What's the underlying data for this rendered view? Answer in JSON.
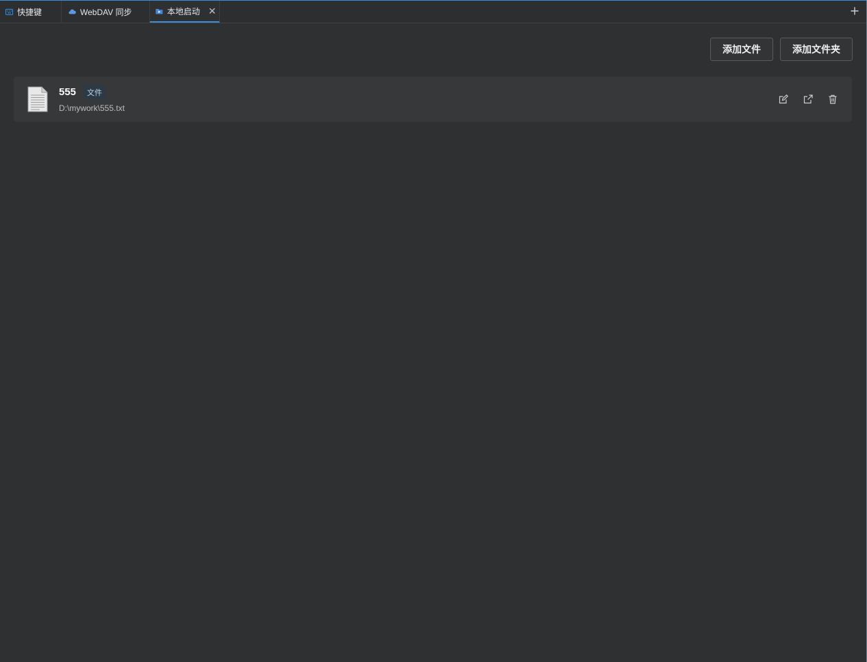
{
  "tabs": [
    {
      "label": "快捷键",
      "icon": "keyboard-icon"
    },
    {
      "label": "WebDAV 同步",
      "icon": "cloud-icon"
    },
    {
      "label": "本地启动",
      "icon": "folder-run-icon",
      "active": true,
      "close_icon": "close-icon"
    }
  ],
  "tabbar": {
    "add_icon": "plus-icon"
  },
  "toolbar": {
    "add_file_label": "添加文件",
    "add_folder_label": "添加文件夹"
  },
  "items": [
    {
      "name": "555",
      "type_badge": "文件",
      "path": "D:\\mywork\\555.txt",
      "icon": "text-file-icon",
      "actions": [
        "edit-icon",
        "open-external-icon",
        "delete-icon"
      ]
    }
  ],
  "colors": {
    "accent": "#3a8fd8",
    "background": "#2f3032",
    "card": "#37383a"
  }
}
